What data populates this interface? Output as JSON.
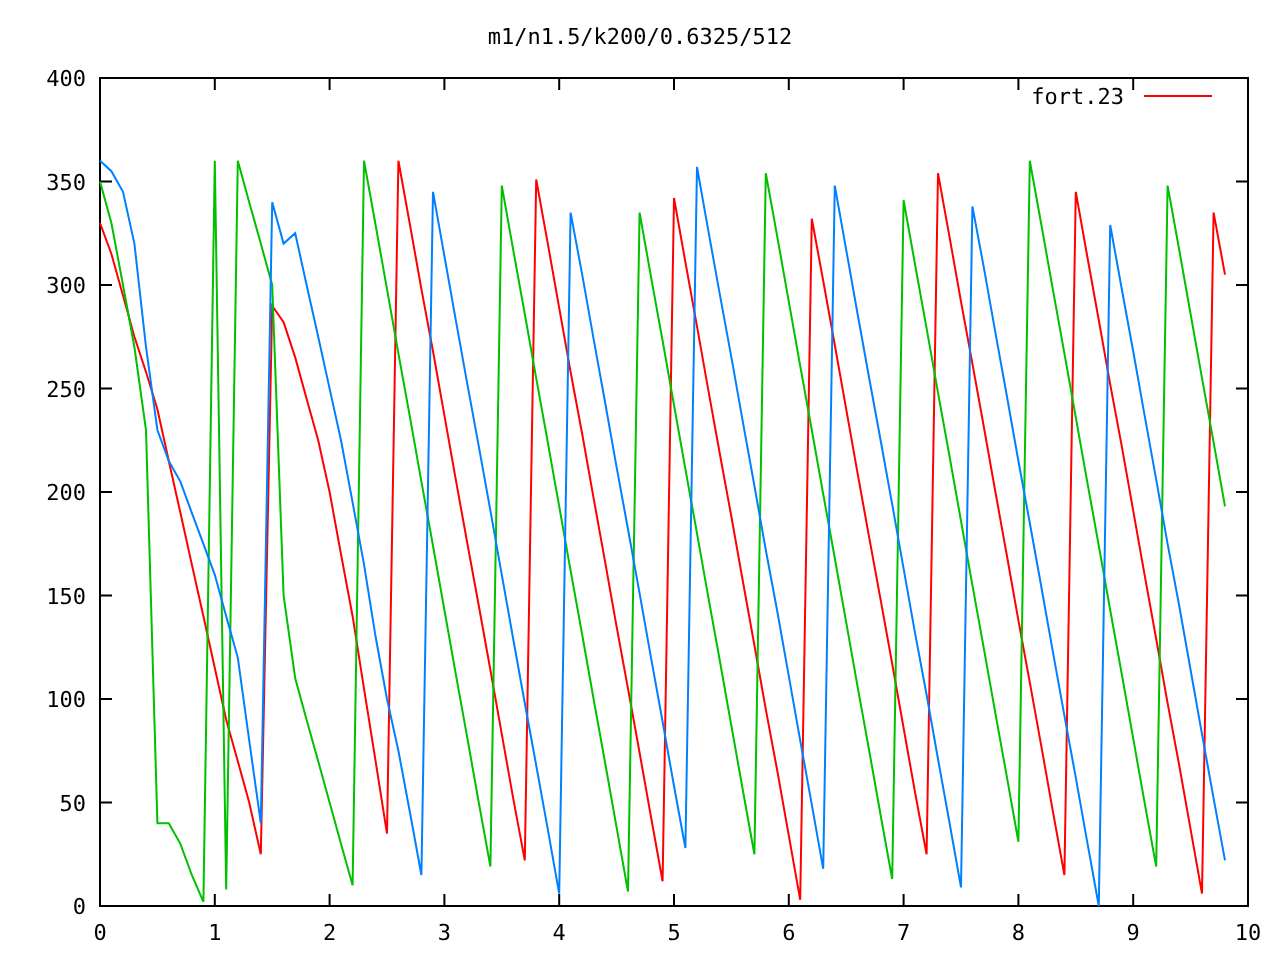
{
  "plot": {
    "chart_data": {
      "type": "line",
      "title": "m1/n1.5/k200/0.6325/512",
      "x": [
        0,
        0.1,
        0.2,
        0.3,
        0.4,
        0.5,
        0.6,
        0.7,
        0.8,
        0.9,
        1,
        1.1,
        1.2,
        1.3,
        1.4,
        1.5,
        1.6,
        1.7,
        1.8,
        1.9,
        2,
        2.1,
        2.2,
        2.3,
        2.4,
        2.5,
        2.6,
        2.7,
        2.8,
        2.9,
        3,
        3.1,
        3.2,
        3.3,
        3.4,
        3.5,
        3.6,
        3.7,
        3.8,
        3.9,
        4,
        4.1,
        4.2,
        4.3,
        4.4,
        4.5,
        4.6,
        4.7,
        4.8,
        4.9,
        5,
        5.1,
        5.2,
        5.3,
        5.4,
        5.5,
        5.6,
        5.7,
        5.8,
        5.9,
        6,
        6.1,
        6.2,
        6.3,
        6.4,
        6.5,
        6.6,
        6.7,
        6.8,
        6.9,
        7,
        7.1,
        7.2,
        7.3,
        7.4,
        7.5,
        7.6,
        7.7,
        7.8,
        7.9,
        8,
        8.1,
        8.2,
        8.3,
        8.4,
        8.5,
        8.6,
        8.7,
        8.8,
        8.9,
        9,
        9.1,
        9.2,
        9.3,
        9.4,
        9.5,
        9.6,
        9.7,
        9.8
      ],
      "series": [
        {
          "name": "fort.23",
          "color": "#ff0000",
          "values": [
            330,
            315,
            295,
            275,
            258,
            240,
            215,
            190,
            165,
            140,
            115,
            90,
            70,
            50,
            25,
            290,
            282,
            265,
            245,
            225,
            200,
            170,
            140,
            105,
            70,
            35,
            360,
            329,
            298,
            268,
            237,
            206,
            175,
            145,
            114,
            83,
            52,
            22,
            351,
            320,
            289,
            258,
            228,
            197,
            166,
            135,
            105,
            74,
            43,
            12,
            342,
            311,
            280,
            249,
            218,
            188,
            157,
            126,
            95,
            65,
            34,
            3,
            332,
            302,
            271,
            240,
            209,
            178,
            148,
            117,
            86,
            55,
            25,
            354,
            323,
            292,
            262,
            231,
            200,
            169,
            138,
            108,
            77,
            46,
            15,
            345,
            314,
            283,
            252,
            222,
            191,
            160,
            129,
            98,
            68,
            37,
            6,
            335,
            305
          ]
        },
        {
          "color": "#00c000",
          "values": [
            350,
            330,
            300,
            270,
            230,
            40,
            40,
            30,
            15,
            2,
            360,
            8,
            360,
            340,
            320,
            300,
            150,
            110,
            90,
            70,
            50,
            30,
            10,
            360,
            329,
            298,
            267,
            236,
            205,
            174,
            143,
            112,
            81,
            50,
            19,
            348,
            317,
            286,
            255,
            224,
            193,
            162,
            131,
            100,
            69,
            38,
            7,
            335,
            304,
            273,
            242,
            211,
            180,
            149,
            118,
            87,
            56,
            25,
            354,
            323,
            292,
            261,
            230,
            199,
            168,
            137,
            106,
            75,
            44,
            13,
            341,
            310,
            279,
            248,
            217,
            186,
            155,
            124,
            93,
            62,
            31,
            360,
            329,
            298,
            267,
            236,
            205,
            174,
            143,
            112,
            81,
            50,
            19,
            348,
            317,
            286,
            255,
            224,
            193
          ]
        },
        {
          "color": "#0080ff",
          "values": [
            360,
            355,
            345,
            320,
            270,
            230,
            215,
            205,
            190,
            175,
            160,
            140,
            120,
            80,
            40,
            340,
            320,
            325,
            300,
            275,
            250,
            225,
            195,
            165,
            130,
            100,
            75,
            45,
            15,
            345,
            314,
            283,
            252,
            222,
            191,
            160,
            129,
            98,
            68,
            37,
            6,
            335,
            305,
            274,
            243,
            212,
            182,
            151,
            120,
            89,
            58,
            28,
            357,
            326,
            295,
            265,
            234,
            203,
            172,
            142,
            111,
            80,
            49,
            18,
            348,
            317,
            286,
            255,
            225,
            194,
            163,
            132,
            102,
            71,
            40,
            9,
            338,
            308,
            277,
            246,
            215,
            185,
            154,
            123,
            92,
            62,
            31,
            0,
            329,
            298,
            268,
            237,
            206,
            175,
            145,
            114,
            83,
            52,
            22
          ]
        }
      ],
      "xlim": [
        0,
        10
      ],
      "ylim": [
        0,
        400
      ],
      "xticks": [
        0,
        1,
        2,
        3,
        4,
        5,
        6,
        7,
        8,
        9,
        10
      ],
      "yticks": [
        0,
        50,
        100,
        150,
        200,
        250,
        300,
        350,
        400
      ]
    }
  }
}
